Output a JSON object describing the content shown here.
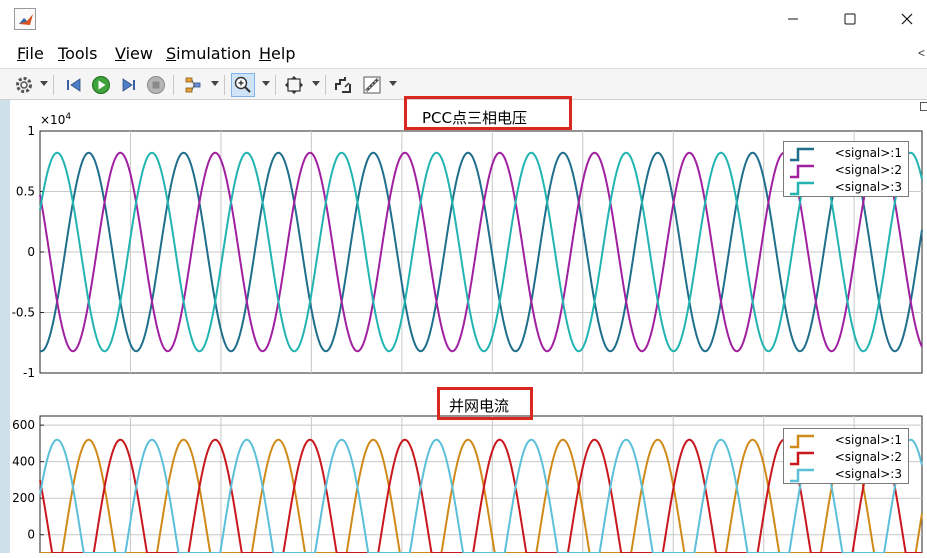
{
  "window": {
    "title": "",
    "icon": "matlab-icon",
    "controls": [
      "minimize-icon",
      "maximize-icon",
      "close-icon"
    ]
  },
  "menu": [
    {
      "label": "File",
      "underline": "F",
      "rest": "ile"
    },
    {
      "label": "Tools",
      "underline": "T",
      "rest": "ools"
    },
    {
      "label": "View",
      "underline": "V",
      "rest": "iew"
    },
    {
      "label": "Simulation",
      "underline": "S",
      "rest": "imulation"
    },
    {
      "label": "Help",
      "underline": "H",
      "rest": "elp"
    }
  ],
  "menu_more": "<",
  "toolbar": [
    "configuration-gear-icon",
    "dropdown-icon",
    "step-back-icon",
    "run-icon",
    "step-forward-icon",
    "stop-icon",
    "signal-selector-icon",
    "dropdown-icon",
    "zoom-in-icon",
    "dropdown-icon",
    "fit-to-view-icon",
    "dropdown-icon",
    "autoscale-icon",
    "measurements-icon",
    "dropdown-icon"
  ],
  "colors": {
    "highlight_box": "#d9281d",
    "top_signal_1": "#1f6e8c",
    "top_signal_2": "#a020a0",
    "top_signal_3": "#22b4b0",
    "bottom_signal_1": "#d08a1a",
    "bottom_signal_2": "#c8181e",
    "bottom_signal_3": "#5bc0d8"
  },
  "chart_data": [
    {
      "type": "line",
      "title": "PCC点三相电压",
      "ylabel": "",
      "xlabel": "",
      "yscale_exponent": "×10^4",
      "exp_base": "×10",
      "exp_power": "4",
      "ylim": [
        -1,
        1
      ],
      "yticks": [
        "1",
        "0.5",
        "0",
        "-0.5",
        "-1"
      ],
      "grid": true,
      "legend_position": "top-right",
      "series": [
        {
          "name": "<signal>:1",
          "amplitude": 0.82,
          "phase_deg": 0
        },
        {
          "name": "<signal>:2",
          "amplitude": 0.82,
          "phase_deg": -120
        },
        {
          "name": "<signal>:3",
          "amplitude": 0.82,
          "phase_deg": 120
        }
      ],
      "cycles_visible": 9.3
    },
    {
      "type": "line",
      "title": "并网电流",
      "ylabel": "",
      "xlabel": "",
      "ylim": [
        -100,
        650
      ],
      "yticks": [
        "600",
        "400",
        "200",
        "0"
      ],
      "grid": true,
      "legend_position": "top-right",
      "series": [
        {
          "name": "<signal>:1",
          "amplitude": 520,
          "phase_deg": 0
        },
        {
          "name": "<signal>:2",
          "amplitude": 520,
          "phase_deg": -120
        },
        {
          "name": "<signal>:3",
          "amplitude": 520,
          "phase_deg": 120
        }
      ],
      "cycles_visible": 9.3
    }
  ]
}
